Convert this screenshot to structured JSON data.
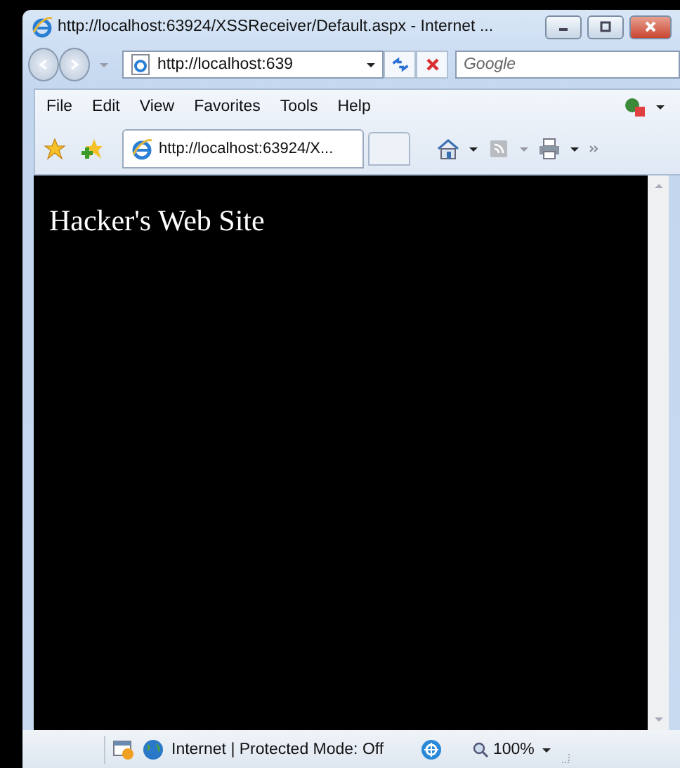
{
  "window": {
    "title": "http://localhost:63924/XSSReceiver/Default.aspx - Internet ..."
  },
  "address_bar": {
    "value": "http://localhost:639"
  },
  "search": {
    "placeholder": "Google"
  },
  "menu": [
    "File",
    "Edit",
    "View",
    "Favorites",
    "Tools",
    "Help"
  ],
  "tabs": [
    {
      "label": "http://localhost:63924/X...",
      "selected": true
    }
  ],
  "page": {
    "heading": "Hacker's Web Site"
  },
  "status_bar": {
    "zone": "Internet | Protected Mode: Off",
    "zoom": "100%"
  }
}
